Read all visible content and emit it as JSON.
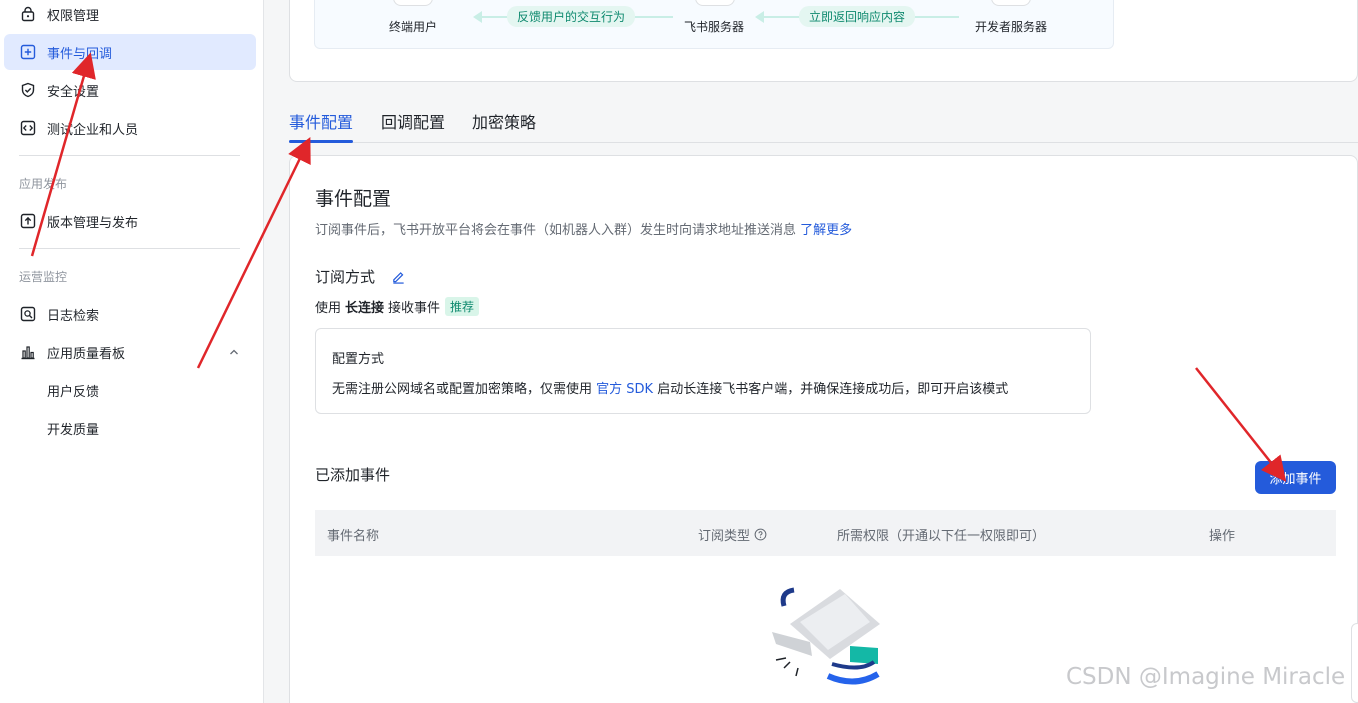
{
  "sidebar": {
    "items": [
      {
        "label": "权限管理",
        "icon": "lock-icon",
        "active": false
      },
      {
        "label": "事件与回调",
        "icon": "plus-square-icon",
        "active": true
      },
      {
        "label": "安全设置",
        "icon": "shield-icon",
        "active": false
      },
      {
        "label": "测试企业和人员",
        "icon": "code-icon",
        "active": false
      }
    ],
    "group_publish": "应用发布",
    "publish_items": [
      {
        "label": "版本管理与发布",
        "icon": "upload-icon"
      }
    ],
    "group_monitor": "运营监控",
    "monitor_items": [
      {
        "label": "日志检索",
        "icon": "log-search-icon"
      },
      {
        "label": "应用质量看板",
        "icon": "bar-chart-icon"
      }
    ],
    "sub_items": [
      "用户反馈",
      "开发质量"
    ]
  },
  "flow": {
    "node_user": "终端用户",
    "node_feishu": "飞书服务器",
    "node_dev": "开发者服务器",
    "tag_feedback": "反馈用户的交互行为",
    "tag_return": "立即返回响应内容"
  },
  "tabs": [
    "事件配置",
    "回调配置",
    "加密策略"
  ],
  "main": {
    "title": "事件配置",
    "desc": "订阅事件后，飞书开放平台将会在事件（如机器人入群）发生时向请求地址推送消息",
    "desc_link": "了解更多",
    "subscribe_title": "订阅方式",
    "use_prefix": "使用",
    "use_bold": "长连接",
    "use_suffix": "接收事件",
    "recommend_tag": "推荐",
    "config_label": "配置方式",
    "config_text_a": "无需注册公网域名或配置加密策略，仅需使用",
    "config_link": "官方 SDK",
    "config_text_b": "启动长连接飞书客户端，并确保连接成功后，即可开启该模式",
    "added_title": "已添加事件",
    "add_button": "添加事件",
    "table_headers": [
      "事件名称",
      "订阅类型",
      "所需权限（开通以下任一权限即可）",
      "操作"
    ]
  },
  "watermark": "CSDN @Imagine Miracle",
  "colors": {
    "accent": "#245bdb",
    "active_bg": "#e1eaff",
    "annotation_red": "#e0262a"
  }
}
